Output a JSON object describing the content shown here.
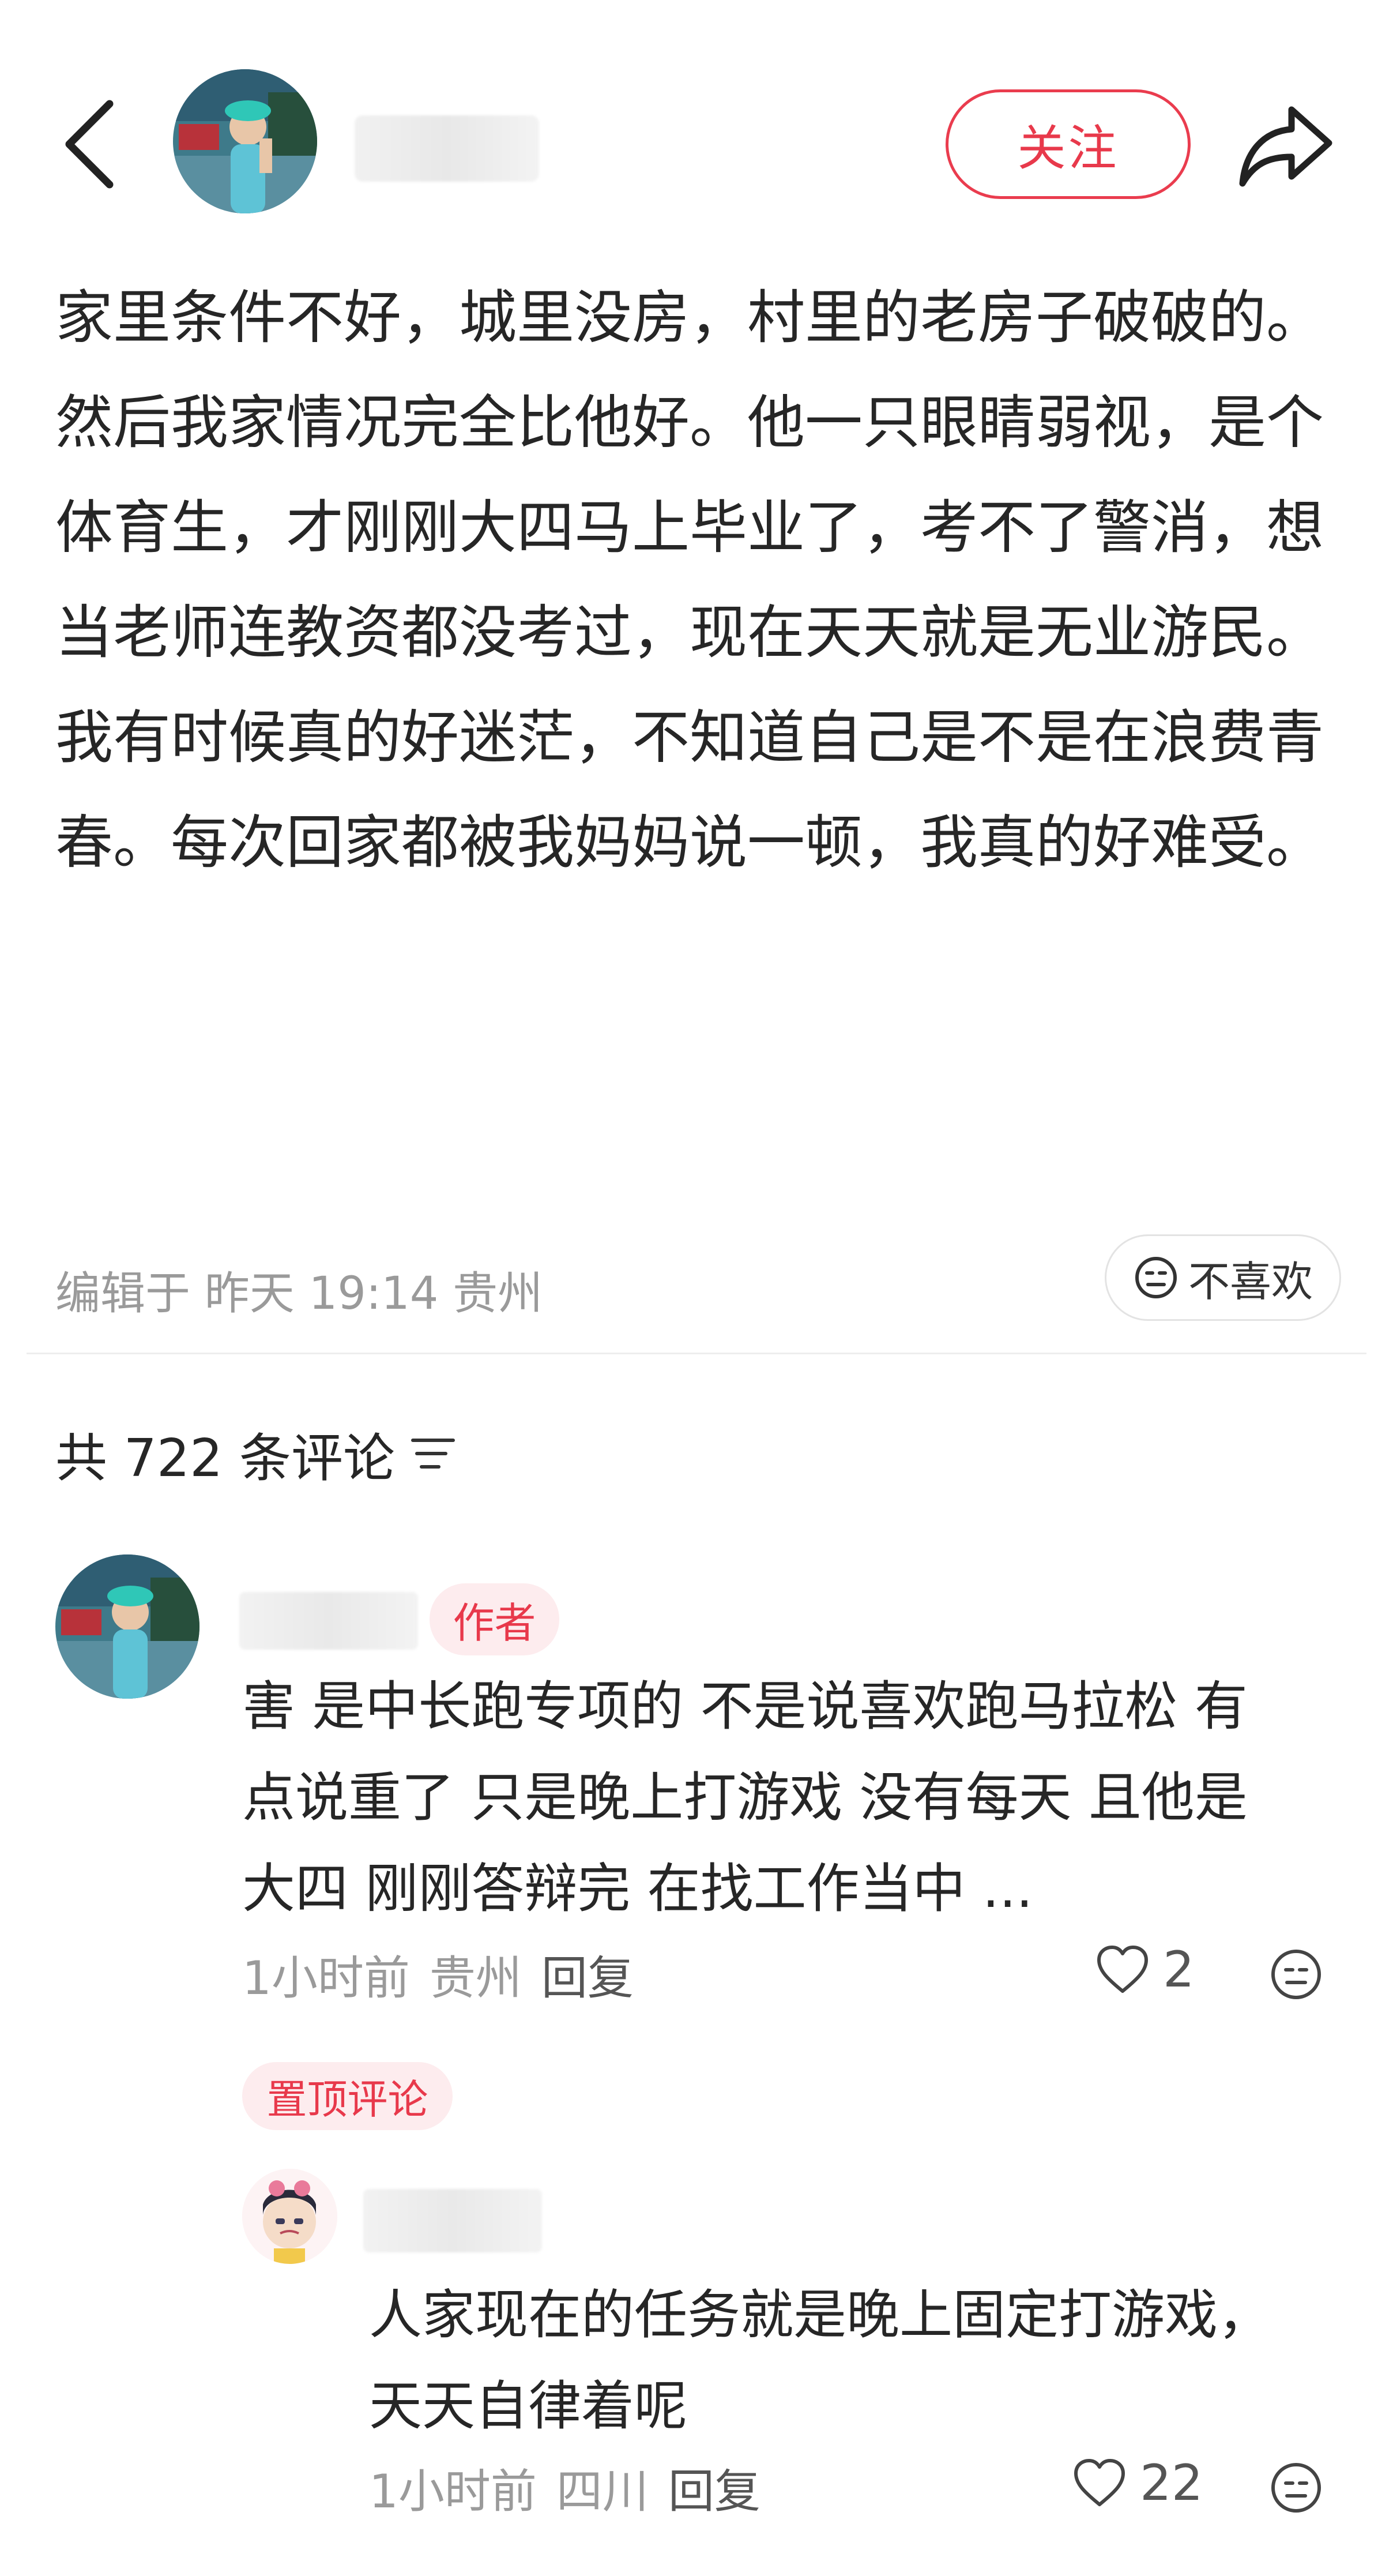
{
  "header": {
    "follow_label": "关注"
  },
  "post": {
    "paragraphs": [
      "家里条件不好，城里没房，村里的老房子破破的。",
      "然后我家情况完全比他好。他一只眼睛弱视，是个体育生，才刚刚大四马上毕业了，考不了警消，想当老师连教资都没考过，现在天天就是无业游民。",
      "我有时候真的好迷茫，不知道自己是不是在浪费青春。每次回家都被我妈妈说一顿，我真的好难受。"
    ],
    "edit_info": "编辑于 昨天 19:14 贵州",
    "dislike_label": "不喜欢"
  },
  "comments_header": {
    "count_text": "共 722 条评论"
  },
  "comments": [
    {
      "author_tag": "作者",
      "lines": [
        "害 是中长跑专项的 不是说喜欢跑马拉松 有",
        "点说重了 只是晚上打游戏 没有每天 且他是",
        "大四 刚刚答辩完 在找工作当中 ..."
      ],
      "time": "1小时前",
      "location": "贵州",
      "reply_label": "回复",
      "likes": "2",
      "pinned_label": "置顶评论"
    },
    {
      "lines": [
        "人家现在的任务就是晚上固定打游戏，",
        "天天自律着呢"
      ],
      "time": "1小时前",
      "location": "四川",
      "reply_label": "回复",
      "likes": "22"
    }
  ],
  "colors": {
    "accent": "#e8394b",
    "tag_bg": "#fdecee",
    "meta": "#9a9a9a"
  },
  "icons": [
    "back-arrow-icon",
    "share-icon",
    "dislike-face-icon",
    "sort-icon",
    "heart-icon",
    "neutral-face-icon"
  ]
}
